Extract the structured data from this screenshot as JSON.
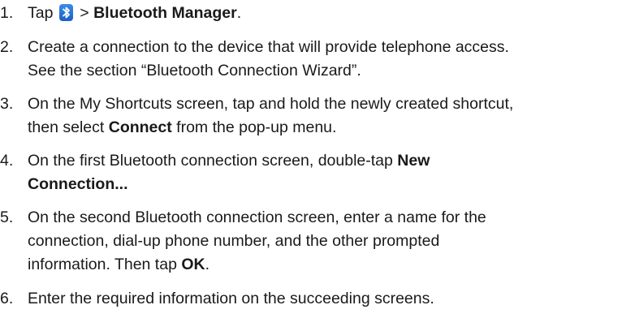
{
  "icons": {
    "bluetooth": "bluetooth-icon"
  },
  "steps": [
    {
      "number": "1.",
      "lines": [
        {
          "a": "Tap ",
          "b": " > ",
          "c": "Bluetooth Manager",
          "d": "."
        }
      ]
    },
    {
      "number": "2.",
      "lines": [
        "Create a connection to the device that will provide telephone access.",
        "See the section “Bluetooth Connection Wizard”."
      ]
    },
    {
      "number": "3.",
      "lines": [
        "On the My Shortcuts screen, tap and hold the newly created shortcut,",
        {
          "a": "then select ",
          "b": "Connect",
          "c": " from the pop-up menu."
        }
      ]
    },
    {
      "number": "4.",
      "lines": [
        {
          "a": "On the first Bluetooth connection screen, double-tap ",
          "b": "New"
        },
        {
          "b": "Connection..."
        }
      ]
    },
    {
      "number": "5.",
      "lines": [
        "On the second Bluetooth connection screen, enter a name for the",
        "connection, dial-up phone number, and the other prompted",
        {
          "a": "information. Then tap  ",
          "b": "OK",
          "c": "."
        }
      ]
    },
    {
      "number": "6.",
      "lines": [
        "Enter the required information on the succeeding screens."
      ]
    }
  ]
}
